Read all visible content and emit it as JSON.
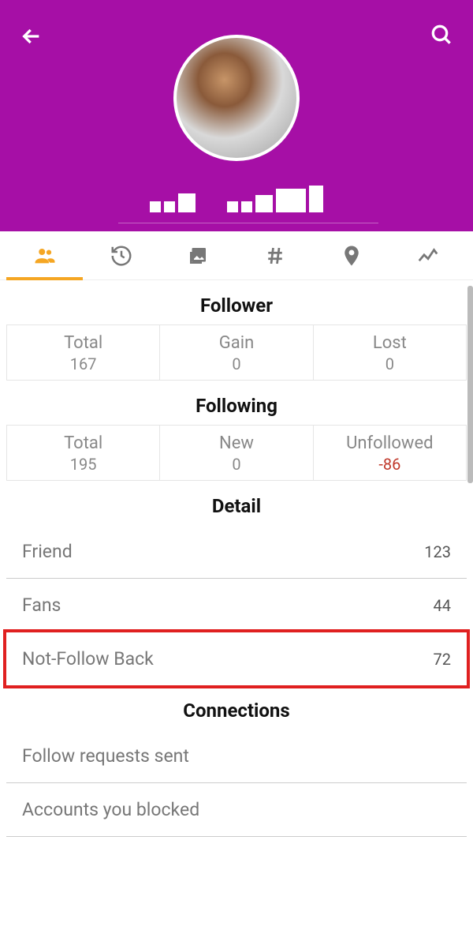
{
  "header": {
    "back_icon": "back-arrow",
    "search_icon": "search"
  },
  "sections": {
    "follower": {
      "title": "Follower",
      "total_label": "Total",
      "total_value": "167",
      "gain_label": "Gain",
      "gain_value": "0",
      "lost_label": "Lost",
      "lost_value": "0"
    },
    "following": {
      "title": "Following",
      "total_label": "Total",
      "total_value": "195",
      "new_label": "New",
      "new_value": "0",
      "unfollowed_label": "Unfollowed",
      "unfollowed_value": "-86"
    },
    "detail": {
      "title": "Detail",
      "friend_label": "Friend",
      "friend_value": "123",
      "fans_label": "Fans",
      "fans_value": "44",
      "notfollow_label": "Not-Follow Back",
      "notfollow_value": "72"
    },
    "connections": {
      "title": "Connections",
      "requests_label": "Follow requests sent",
      "blocked_label": "Accounts you blocked"
    }
  }
}
